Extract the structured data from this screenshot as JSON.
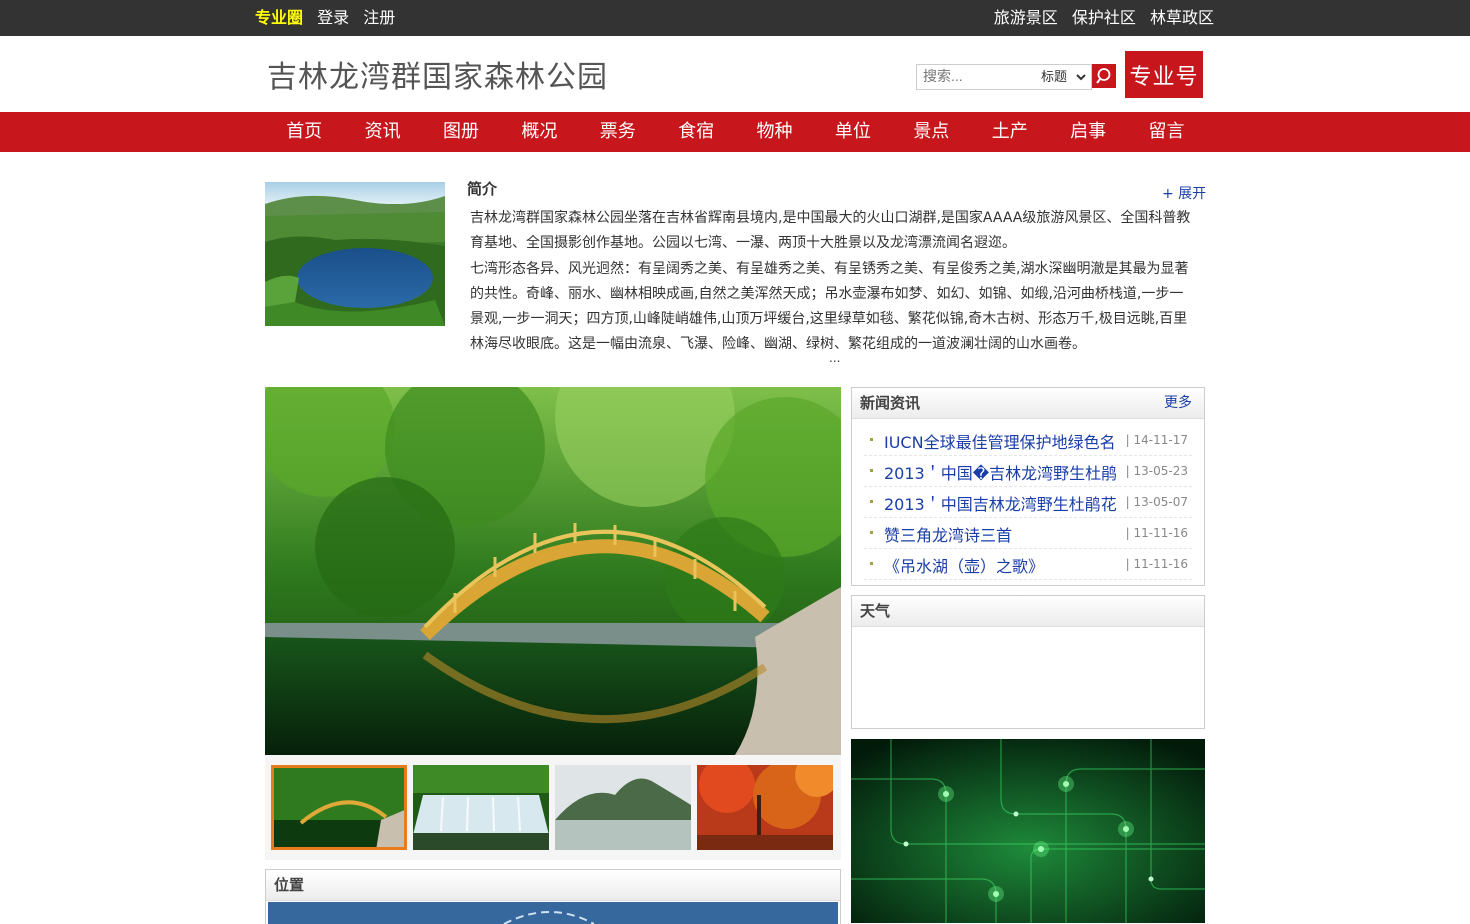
{
  "topbar": {
    "brand": "专业圈",
    "login": "登录",
    "register": "注册",
    "links": [
      "旅游景区",
      "保护社区",
      "林草政区"
    ]
  },
  "header": {
    "site_title": "吉林龙湾群国家森林公园",
    "search_placeholder": "搜索...",
    "search_scope": "标题",
    "badge": "专业号"
  },
  "nav": [
    "首页",
    "资讯",
    "图册",
    "概况",
    "票务",
    "食宿",
    "物种",
    "单位",
    "景点",
    "土产",
    "启事",
    "留言"
  ],
  "intro": {
    "title": "简介",
    "expand": "+ 展开",
    "p1": "吉林龙湾群国家森林公园坐落在吉林省辉南县境内,是中国最大的火山口湖群,是国家AAAA级旅游风景区、全国科普教育基地、全国摄影创作基地。公园以七湾、一瀑、两顶十大胜景以及龙湾漂流闻名遐迩。",
    "p2": "七湾形态各异、风光迥然：有呈阔秀之美、有呈雄秀之美、有呈锈秀之美、有呈俊秀之美,湖水深幽明澈是其最为显著的共性。奇峰、丽水、幽林相映成画,自然之美浑然天成；吊水壶瀑布如梦、如幻、如锦、如缎,沿河曲桥栈道,一步一景观,一步一洞天；四方顶,山峰陡峭雄伟,山顶万坪缓台,这里绿草如毯、繁花似锦,奇木古树、形态万千,极目远眺,百里林海尽收眼底。这是一幅由流泉、飞瀑、险峰、幽湖、绿树、繁花组成的一道波澜壮阔的山水画卷。",
    "ellipsis": "..."
  },
  "location": {
    "title": "位置"
  },
  "news": {
    "title": "新闻资讯",
    "more": "更多",
    "items": [
      {
        "title": "IUCN全球最佳管理保护地绿色名",
        "date": "| 14-11-17"
      },
      {
        "title": "2013＇中国�吉林龙湾野生杜鹃",
        "date": "| 13-05-23"
      },
      {
        "title": "2013＇中国吉林龙湾野生杜鹃花",
        "date": "| 13-05-07"
      },
      {
        "title": "赞三角龙湾诗三首",
        "date": "| 11-11-16"
      },
      {
        "title": "《吊水湖（壶）之歌》",
        "date": "| 11-11-16"
      }
    ]
  },
  "weather": {
    "title": "天气"
  },
  "colors": {
    "nav_red": "#c8161d",
    "topbar": "#333333",
    "link_blue": "#1a3ea8",
    "brand_yellow": "#ffff00",
    "thumb_active": "#e87b1c"
  }
}
